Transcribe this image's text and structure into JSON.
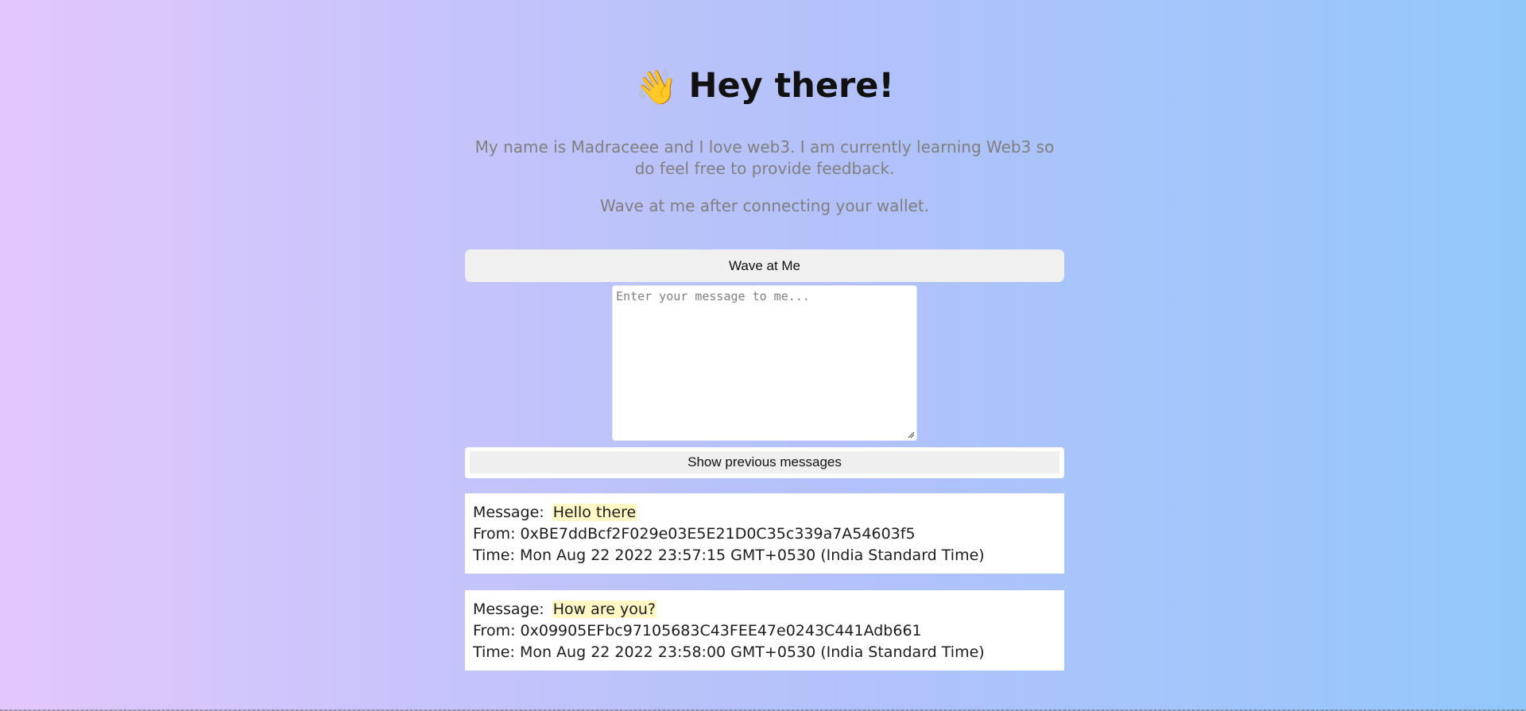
{
  "header": {
    "emoji": "👋",
    "title": "Hey there!"
  },
  "bio": {
    "intro": "My name is Madraceee and I love web3. I am currently learning Web3 so do feel free to provide feedback.",
    "instruction": "Wave at me after connecting your wallet."
  },
  "wave_button": {
    "label": "Wave at Me"
  },
  "message_input": {
    "value": "",
    "placeholder": "Enter your message to me..."
  },
  "show_previous_button": {
    "label": "Show previous messages"
  },
  "labels": {
    "message": "Message:",
    "from": "From:",
    "time": "Time:"
  },
  "messages": [
    {
      "message": "Hello there",
      "from": "0xBE7ddBcf2F029e03E5E21D0C35c339a7A54603f5",
      "time": "Mon Aug 22 2022 23:57:15 GMT+0530 (India Standard Time)"
    },
    {
      "message": "How are you?",
      "from": "0x09905EFbc97105683C43FEE47e0243C441Adb661",
      "time": "Mon Aug 22 2022 23:58:00 GMT+0530 (India Standard Time)"
    }
  ],
  "colors": {
    "gradient_start": "#e3c7fc",
    "gradient_end": "#92c7fc",
    "message_highlight": "#fff8c4",
    "button_bg": "#f0f0f0",
    "muted_text": "#7f7f7f"
  },
  "icons": {
    "wave": "waving-hand-icon",
    "resize": "resize-grip-icon"
  }
}
